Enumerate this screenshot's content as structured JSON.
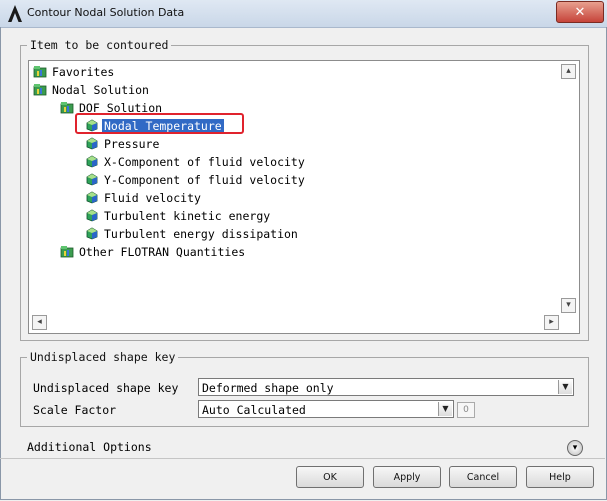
{
  "window": {
    "title": "Contour Nodal Solution Data",
    "close_glyph": "✕"
  },
  "item_group": {
    "legend": "Item to be contoured",
    "tree": [
      {
        "label": "Favorites",
        "icon": "folder-results-icon",
        "level": 0,
        "selected": false
      },
      {
        "label": "Nodal Solution",
        "icon": "folder-results-icon",
        "level": 0,
        "selected": false
      },
      {
        "label": "DOF Solution",
        "icon": "folder-results-icon",
        "level": 1,
        "selected": false
      },
      {
        "label": "Nodal Temperature",
        "icon": "cube-icon",
        "level": 2,
        "selected": true
      },
      {
        "label": "Pressure",
        "icon": "cube-icon",
        "level": 2,
        "selected": false
      },
      {
        "label": "X-Component of fluid velocity",
        "icon": "cube-icon",
        "level": 2,
        "selected": false
      },
      {
        "label": "Y-Component of fluid velocity",
        "icon": "cube-icon",
        "level": 2,
        "selected": false
      },
      {
        "label": "Fluid velocity",
        "icon": "cube-icon",
        "level": 2,
        "selected": false
      },
      {
        "label": "Turbulent kinetic energy",
        "icon": "cube-icon",
        "level": 2,
        "selected": false
      },
      {
        "label": "Turbulent energy dissipation",
        "icon": "cube-icon",
        "level": 2,
        "selected": false
      },
      {
        "label": "Other FLOTRAN Quantities",
        "icon": "folder-results-icon",
        "level": 1,
        "selected": false
      }
    ]
  },
  "undisplaced_group": {
    "legend": "Undisplaced shape key",
    "shape_key_label": "Undisplaced shape key",
    "shape_key_value": "Deformed shape only",
    "scale_factor_label": "Scale Factor",
    "scale_factor_value": "Auto Calculated",
    "scale_factor_extra": "0"
  },
  "additional_options": {
    "label": "Additional Options"
  },
  "buttons": {
    "ok": "OK",
    "apply": "Apply",
    "cancel": "Cancel",
    "help": "Help"
  },
  "colors": {
    "selection": "#316ac5",
    "highlight_outline": "#e0232d"
  }
}
